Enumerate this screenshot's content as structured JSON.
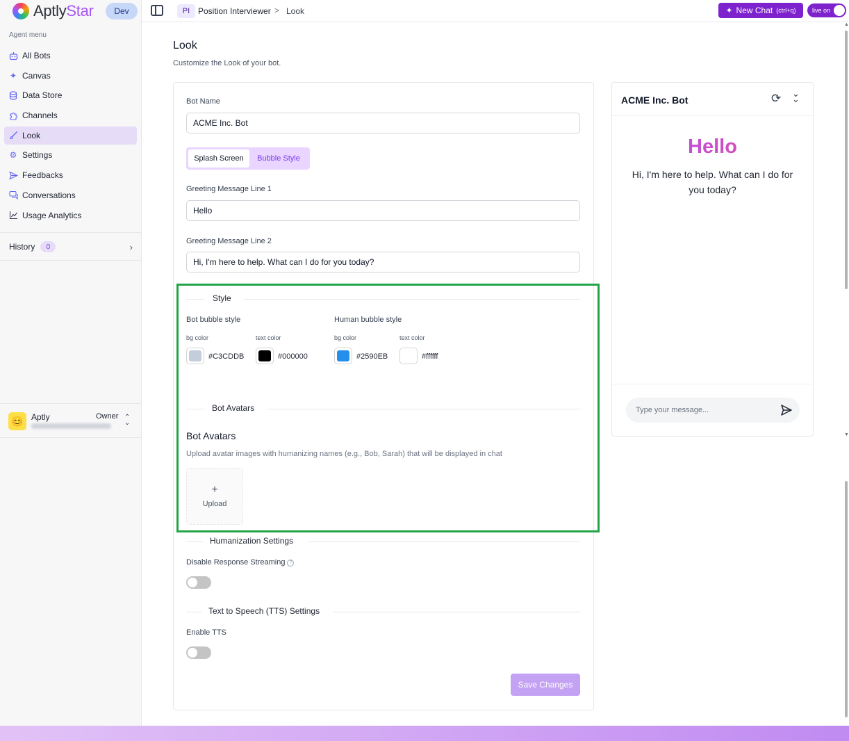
{
  "brand": {
    "name_part1": "Aptly",
    "name_part2": "Star",
    "env_badge": "Dev"
  },
  "sidebar": {
    "section_label": "Agent menu",
    "items": [
      {
        "label": "All Bots",
        "icon": "bot-icon"
      },
      {
        "label": "Canvas",
        "icon": "sparkles-icon"
      },
      {
        "label": "Data Store",
        "icon": "database-icon"
      },
      {
        "label": "Channels",
        "icon": "puzzle-icon"
      },
      {
        "label": "Look",
        "icon": "brush-icon",
        "active": true
      },
      {
        "label": "Settings",
        "icon": "gear-icon"
      },
      {
        "label": "Feedbacks",
        "icon": "send-icon"
      },
      {
        "label": "Conversations",
        "icon": "chat-icon"
      },
      {
        "label": "Usage Analytics",
        "icon": "chart-icon"
      }
    ],
    "history": {
      "label": "History",
      "count": "0"
    },
    "user": {
      "name": "Aptly",
      "role": "Owner"
    }
  },
  "topbar": {
    "project_badge": "PI",
    "project_name": "Position Interviewer",
    "separator": ">",
    "page": "Look",
    "new_chat_label": "New Chat",
    "new_chat_shortcut": "(ctrl+q)",
    "live_label": "live on"
  },
  "page": {
    "title": "Look",
    "subtitle": "Customize the Look of your bot."
  },
  "form": {
    "bot_name_label": "Bot Name",
    "bot_name_value": "ACME Inc. Bot",
    "tabs": [
      {
        "label": "Splash Screen",
        "active": true
      },
      {
        "label": "Bubble Style",
        "active": false
      }
    ],
    "greeting1_label": "Greeting Message Line 1",
    "greeting1_value": "Hello",
    "greeting2_label": "Greeting Message Line 2",
    "greeting2_value": "Hi, I'm here to help. What can I do for you today?",
    "style": {
      "heading": "Style",
      "bot_bubble_label": "Bot bubble style",
      "human_bubble_label": "Human bubble style",
      "bg_color_label": "bg color",
      "text_color_label": "text color",
      "bot_bg": "#C3CDDB",
      "bot_text": "#000000",
      "human_bg": "#2590EB",
      "human_text": "#ffffff"
    },
    "avatars": {
      "heading": "Bot Avatars",
      "title": "Bot Avatars",
      "description": "Upload avatar images with humanizing names (e.g., Bob, Sarah) that will be displayed in chat",
      "upload_plus": "+",
      "upload_label": "Upload"
    },
    "humanization": {
      "heading": "Humanization Settings",
      "streaming_label": "Disable Response Streaming",
      "streaming_help": "?",
      "streaming_enabled": false
    },
    "tts": {
      "heading": "Text to Speech (TTS) Settings",
      "enable_label": "Enable TTS",
      "enabled": false
    },
    "save_label": "Save Changes"
  },
  "preview": {
    "title": "ACME Inc. Bot",
    "greeting1": "Hello",
    "greeting2": "Hi, I'm here to help. What can I do for you today?",
    "input_placeholder": "Type your message..."
  },
  "colors": {
    "accent": "#7e22ce",
    "active_nav_bg": "#e6dcf7",
    "highlight_border": "#22a447",
    "save_button": "#c4a2f3"
  }
}
